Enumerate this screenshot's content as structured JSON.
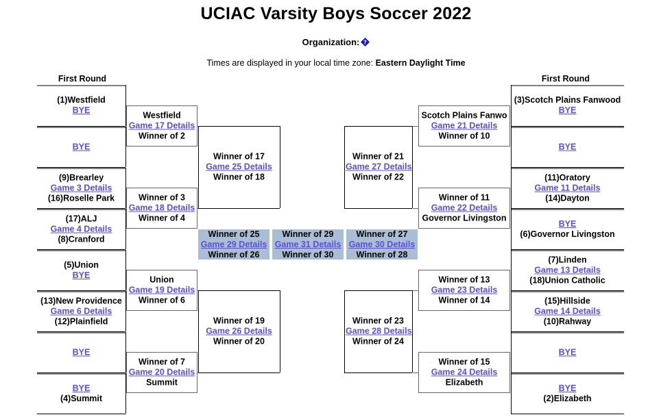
{
  "header": {
    "title": "UCIAC Varsity Boys Soccer 2022",
    "organization_label": "Organization:",
    "organization_icon": "broken-image-icon",
    "timezone_prefix": "Times are displayed in your local time zone:",
    "timezone_value": "Eastern Daylight Time"
  },
  "labels": {
    "first_round_left": "First Round",
    "first_round_right": "First Round",
    "bye": "BYE"
  },
  "colors": {
    "link": "#5b4fd6",
    "highlight": "#a9bed4",
    "border_dark": "#000000",
    "border_gray": "#808080"
  },
  "left": {
    "round1": [
      {
        "top": "(1)Westfield",
        "link": "BYE",
        "bottom": ""
      },
      {
        "top": "",
        "link": "BYE",
        "bottom": ""
      },
      {
        "top": "(9)Brearley",
        "link": "Game 3 Details",
        "bottom": "(16)Roselle Park"
      },
      {
        "top": "(17)ALJ",
        "link": "Game 4 Details",
        "bottom": "(8)Cranford"
      },
      {
        "top": "(5)Union",
        "link": "BYE",
        "bottom": ""
      },
      {
        "top": "(13)New Providence",
        "link": "Game 6 Details",
        "bottom": "(12)Plainfield"
      },
      {
        "top": "",
        "link": "BYE",
        "bottom": ""
      },
      {
        "top": "",
        "link": "BYE",
        "bottom": "(4)Summit"
      }
    ],
    "round2": [
      {
        "top": "Westfield",
        "link": "Game 17 Details",
        "bottom": "Winner of 2"
      },
      {
        "top": "Winner of 3",
        "link": "Game 18 Details",
        "bottom": "Winner of 4"
      },
      {
        "top": "Union",
        "link": "Game 19 Details",
        "bottom": "Winner of 6"
      },
      {
        "top": "Winner of 7",
        "link": "Game 20 Details",
        "bottom": "Summit"
      }
    ],
    "round3": [
      {
        "top": "Winner of 17",
        "link": "Game 25 Details",
        "bottom": "Winner of 18"
      },
      {
        "top": "Winner of 19",
        "link": "Game 26 Details",
        "bottom": "Winner of 20"
      }
    ]
  },
  "right": {
    "round1": [
      {
        "top": "(3)Scotch Plains Fanwood",
        "link": "BYE",
        "bottom": ""
      },
      {
        "top": "",
        "link": "BYE",
        "bottom": ""
      },
      {
        "top": "(11)Oratory",
        "link": "Game 11 Details",
        "bottom": "(14)Dayton"
      },
      {
        "top": "",
        "link": "BYE",
        "bottom": "(6)Governor Livingston"
      },
      {
        "top": "(7)Linden",
        "link": "Game 13 Details",
        "bottom": "(18)Union Catholic"
      },
      {
        "top": "(15)Hillside",
        "link": "Game 14 Details",
        "bottom": "(10)Rahway"
      },
      {
        "top": "",
        "link": "BYE",
        "bottom": ""
      },
      {
        "top": "",
        "link": "BYE",
        "bottom": "(2)Elizabeth"
      }
    ],
    "round2": [
      {
        "top": "Scotch Plains Fanwo",
        "link": "Game 21 Details",
        "bottom": "Winner of 10"
      },
      {
        "top": "Winner of 11",
        "link": "Game 22 Details",
        "bottom": "Governor Livingston"
      },
      {
        "top": "Winner of 13",
        "link": "Game 23 Details",
        "bottom": "Winner of 14"
      },
      {
        "top": "Winner of 15",
        "link": "Game 24 Details",
        "bottom": "Elizabeth"
      }
    ],
    "round3": [
      {
        "top": "Winner of 21",
        "link": "Game 27 Details",
        "bottom": "Winner of 22"
      },
      {
        "top": "Winner of 23",
        "link": "Game 28 Details",
        "bottom": "Winner of 24"
      }
    ]
  },
  "center": {
    "semifinal_left": {
      "top": "Winner of 25",
      "link": "Game 29 Details",
      "bottom": "Winner of 26"
    },
    "final": {
      "top": "Winner of 29",
      "link": "Game 31 Details",
      "bottom": "Winner of 30"
    },
    "semifinal_right": {
      "top": "Winner of 27",
      "link": "Game 30 Details",
      "bottom": "Winner of 28"
    }
  }
}
